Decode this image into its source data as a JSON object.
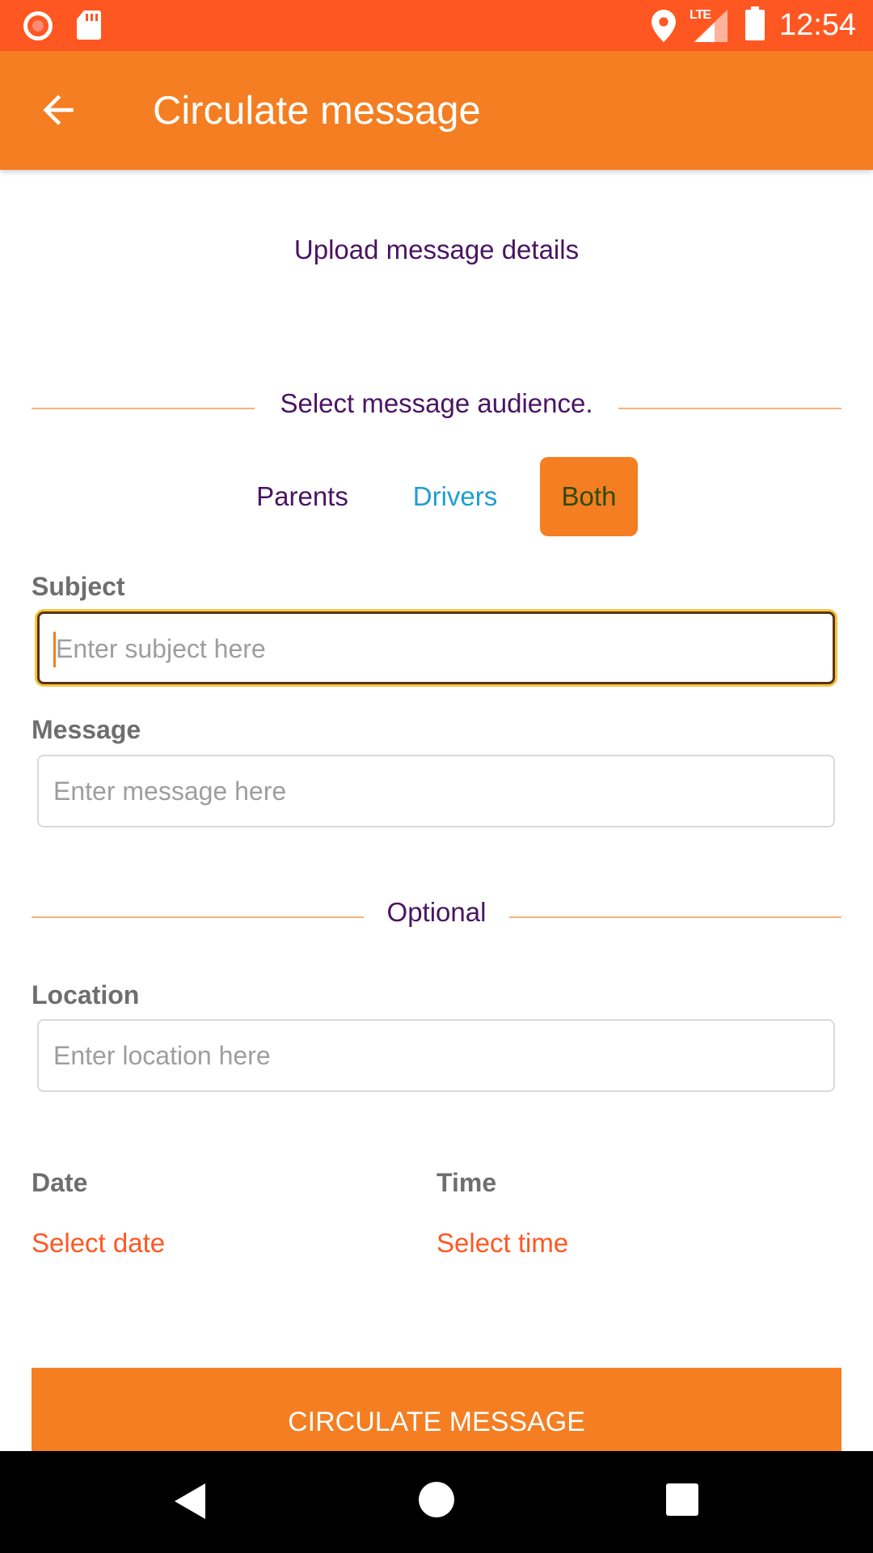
{
  "status_bar": {
    "time": "12:54",
    "network": "LTE",
    "icons": [
      "record-icon",
      "sd-card-icon",
      "location-icon",
      "signal-icon",
      "battery-icon"
    ]
  },
  "app_bar": {
    "title": "Circulate message",
    "back_icon": "arrow-left-icon"
  },
  "form": {
    "upload_heading": "Upload message details",
    "audience_heading": "Select message audience.",
    "audience_options": [
      "Parents",
      "Drivers",
      "Both"
    ],
    "audience_selected": "Both",
    "subject": {
      "label": "Subject",
      "placeholder": "Enter subject here",
      "value": ""
    },
    "message": {
      "label": "Message",
      "placeholder": "Enter message here",
      "value": ""
    },
    "optional_heading": "Optional",
    "location": {
      "label": "Location",
      "placeholder": "Enter location here",
      "value": ""
    },
    "date": {
      "label": "Date",
      "action": "Select date"
    },
    "time": {
      "label": "Time",
      "action": "Select time"
    },
    "submit_label": "CIRCULATE MESSAGE"
  },
  "colors": {
    "status_bar": "#FF5722",
    "app_bar": "#F47E21",
    "heading_text": "#4A1463",
    "link_blue": "#1E9FD0",
    "select_link": "#FF5722",
    "divider": "#F7B27A"
  },
  "nav_bar": {
    "icons": [
      "nav-back-icon",
      "nav-home-icon",
      "nav-recents-icon"
    ]
  }
}
